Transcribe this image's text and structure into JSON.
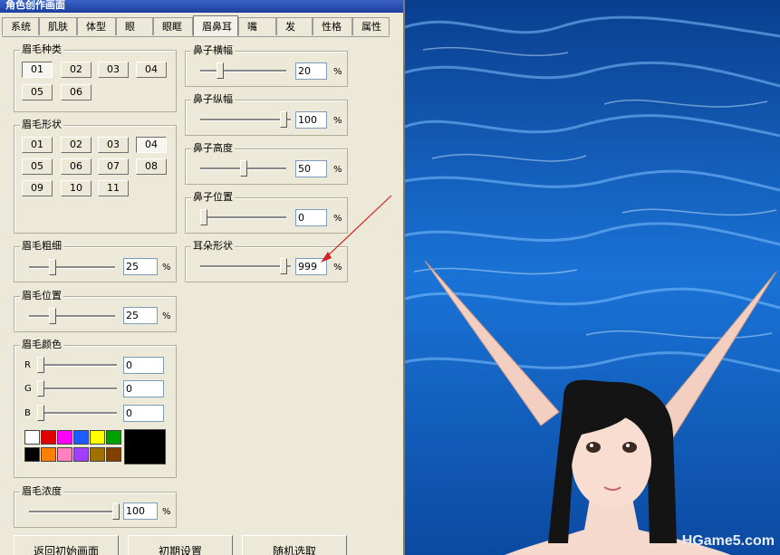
{
  "window": {
    "title": "角色创作画面"
  },
  "tabs": [
    {
      "label": "系统"
    },
    {
      "label": "肌肤"
    },
    {
      "label": "体型"
    },
    {
      "label": "眼"
    },
    {
      "label": "眼眶"
    },
    {
      "label": "眉鼻耳"
    },
    {
      "label": "嘴"
    },
    {
      "label": "发"
    },
    {
      "label": "性格"
    },
    {
      "label": "属性"
    }
  ],
  "active_tab": "眉鼻耳",
  "eyebrow_type": {
    "label": "眉毛种类",
    "options": [
      "01",
      "02",
      "03",
      "04",
      "05",
      "06"
    ],
    "selected": "01"
  },
  "eyebrow_shape": {
    "label": "眉毛形状",
    "options": [
      "01",
      "02",
      "03",
      "04",
      "05",
      "06",
      "07",
      "08",
      "09",
      "10",
      "11"
    ],
    "selected": "04"
  },
  "eyebrow_thickness": {
    "label": "眉毛粗细",
    "value": "25",
    "unit": "%"
  },
  "eyebrow_position": {
    "label": "眉毛位置",
    "value": "25",
    "unit": "%"
  },
  "eyebrow_color": {
    "label": "眉毛颜色",
    "r_label": "R",
    "r_value": "0",
    "g_label": "G",
    "g_value": "0",
    "b_label": "B",
    "b_value": "0",
    "palette": [
      "#ffffff",
      "#e00000",
      "#ff00ff",
      "#1e5cff",
      "#ffff00",
      "#00a000",
      "#000000",
      "#ff8000",
      "#ff80c0",
      "#a040ff",
      "#a07000",
      "#804000"
    ],
    "current_color": "#000000"
  },
  "eyebrow_density": {
    "label": "眉毛浓度",
    "value": "100",
    "unit": "%"
  },
  "nose_width": {
    "label": "鼻子横幅",
    "value": "20",
    "unit": "%"
  },
  "nose_length": {
    "label": "鼻子纵幅",
    "value": "100",
    "unit": "%"
  },
  "nose_height": {
    "label": "鼻子高度",
    "value": "50",
    "unit": "%"
  },
  "nose_position": {
    "label": "鼻子位置",
    "value": "0",
    "unit": "%"
  },
  "ear_shape": {
    "label": "耳朵形状",
    "value": "999",
    "unit": "%"
  },
  "bottom_buttons": {
    "back": "返回初始画面",
    "init": "初期设置",
    "random": "随机选取"
  },
  "watermark": "HGame5.com"
}
